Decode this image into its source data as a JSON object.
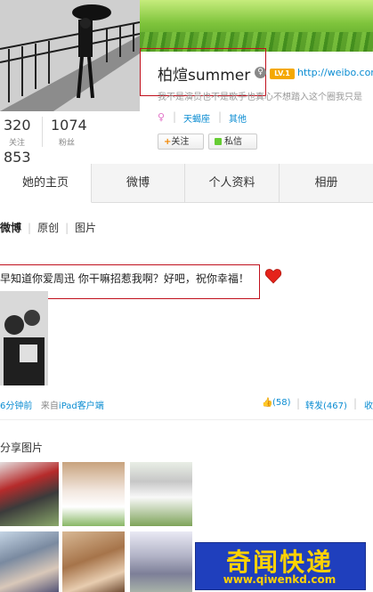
{
  "profile": {
    "name": "柏煊summer",
    "url": "http://weibo.com/",
    "bio": "我不是演员也不是歌手也真心不想踏入这个圈我只是",
    "tags": [
      "天蝎座",
      "其他"
    ],
    "vip": "LV.1"
  },
  "stats": {
    "following": "320",
    "following_label": "关注",
    "fans": "1074",
    "fans_label": "粉丝",
    "posts": "853"
  },
  "buttons": {
    "follow": "关注",
    "message": "私信"
  },
  "tabs": [
    "她的主页",
    "微博",
    "个人资料",
    "相册"
  ],
  "filter": [
    "微博",
    "原创",
    "图片"
  ],
  "post": {
    "text": "早知道你爱周迅 你干嘛招惹我啊？好吧，祝你幸福！",
    "time": "6分钟前",
    "source_prefix": "来自",
    "source": "iPad客户端",
    "likes": "(58)",
    "reposts": "转发(467)",
    "collect": "收"
  },
  "shared": {
    "title": "分享图片"
  },
  "watermark": {
    "text": "奇闻快递",
    "url": "www.qiwenkd.com"
  },
  "colors": {
    "link": "#0a8cd2",
    "highlight_border": "#c0111d",
    "watermark_bg": "#1f3fbd",
    "watermark_fg": "#ffd200"
  }
}
